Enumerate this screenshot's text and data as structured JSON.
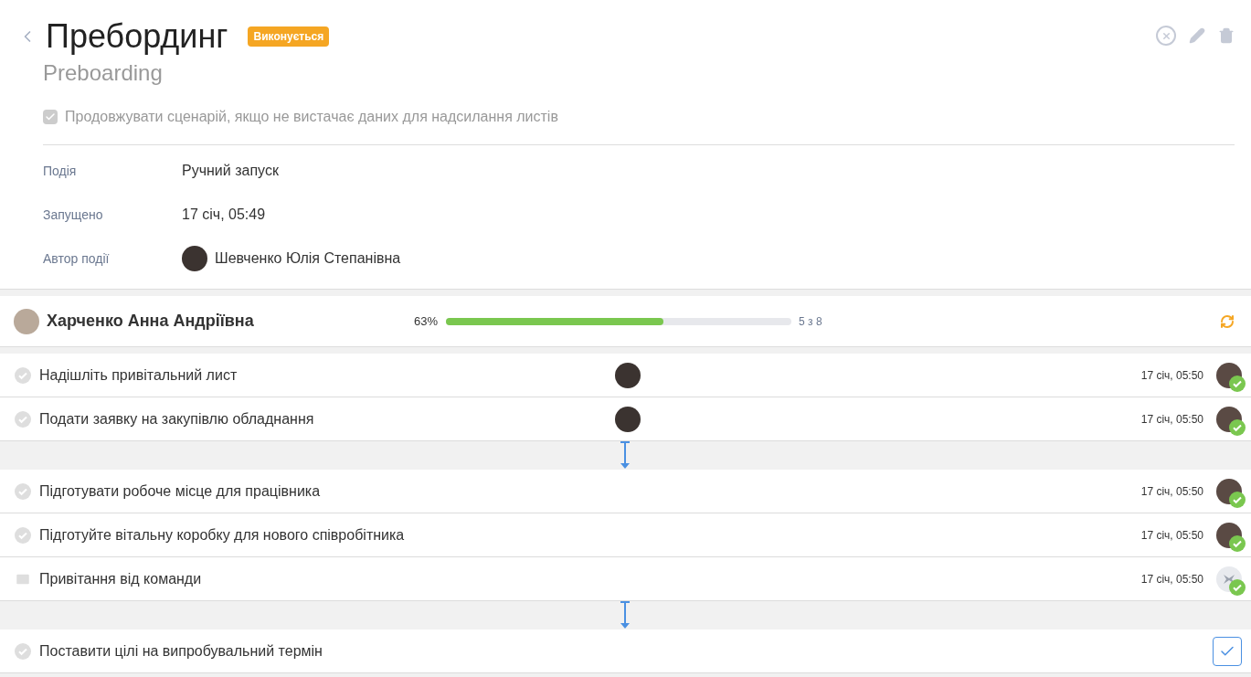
{
  "header": {
    "title": "Пребординг",
    "status": "Виконується",
    "subtitle": "Preboarding"
  },
  "option": {
    "label": "Продовжувати сценарій, якщо не вистачає даних для надсилання листів",
    "checked": true
  },
  "details": [
    {
      "label": "Подія",
      "value": "Ручний запуск",
      "avatar": false
    },
    {
      "label": "Запущено",
      "value": "17 січ, 05:49",
      "avatar": false
    },
    {
      "label": "Автор події",
      "value": "Шевченко Юлія Степанівна",
      "avatar": true
    }
  ],
  "participant": {
    "name": "Харченко Анна Андріївна",
    "percent": "63%",
    "level": 0.63,
    "count": "5 з 8"
  },
  "groups": [
    {
      "tasks": [
        {
          "kind": "task",
          "title": "Надішліть привітальний лист",
          "assignee": true,
          "done": true,
          "time": "17 січ, 05:50",
          "executor": {
            "kind": "person"
          }
        },
        {
          "kind": "task",
          "title": "Подати заявку на закупівлю обладнання",
          "assignee": true,
          "done": true,
          "time": "17 січ, 05:50",
          "executor": {
            "kind": "person"
          }
        }
      ]
    },
    {
      "tasks": [
        {
          "kind": "task",
          "title": "Підготувати робоче місце для працівника",
          "assignee": false,
          "done": true,
          "time": "17 січ, 05:50",
          "executor": {
            "kind": "person"
          }
        },
        {
          "kind": "task",
          "title": "Підготуйте вітальну коробку для нового співробітника",
          "assignee": false,
          "done": true,
          "time": "17 січ, 05:50",
          "executor": {
            "kind": "person"
          }
        },
        {
          "kind": "email",
          "title": "Привітання від команди",
          "assignee": false,
          "done": true,
          "time": "17 січ, 05:50",
          "executor": {
            "kind": "system"
          }
        }
      ]
    },
    {
      "tasks": [
        {
          "kind": "task",
          "title": "Поставити цілі на випробувальний термін",
          "assignee": false,
          "done": false
        }
      ]
    }
  ]
}
